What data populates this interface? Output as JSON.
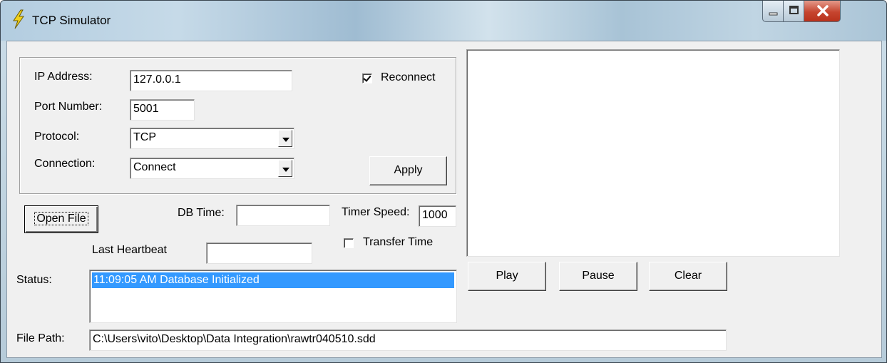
{
  "window": {
    "title": "TCP Simulator",
    "accent": "#3399ff",
    "close_color": "#c6452f"
  },
  "controls": {
    "minimize_icon": "minimize-icon",
    "maximize_icon": "maximize-icon",
    "close_icon": "close-icon"
  },
  "connection": {
    "ip_label": "IP Address:",
    "ip_value": "127.0.0.1",
    "port_label": "Port Number:",
    "port_value": "5001",
    "protocol_label": "Protocol:",
    "protocol_value": "TCP",
    "connection_label": "Connection:",
    "connection_value": "Connect",
    "reconnect_label": "Reconnect",
    "reconnect_checked": true,
    "apply_label": "Apply"
  },
  "controls_row": {
    "open_file_label": "Open File",
    "db_time_label": "DB Time:",
    "db_time_value": "",
    "timer_speed_label": "Timer Speed:",
    "timer_speed_value": "1000",
    "transfer_time_label": "Transfer Time",
    "transfer_time_checked": false,
    "last_heartbeat_label": "Last Heartbeat",
    "last_heartbeat_value": ""
  },
  "status": {
    "label": "Status:",
    "items": [
      "11:09:05 AM  Database Initialized"
    ]
  },
  "file_path": {
    "label": "File Path:",
    "value": "C:\\Users\\vito\\Desktop\\Data Integration\\rawtr040510.sdd"
  },
  "playback": {
    "play_label": "Play",
    "pause_label": "Pause",
    "clear_label": "Clear"
  }
}
